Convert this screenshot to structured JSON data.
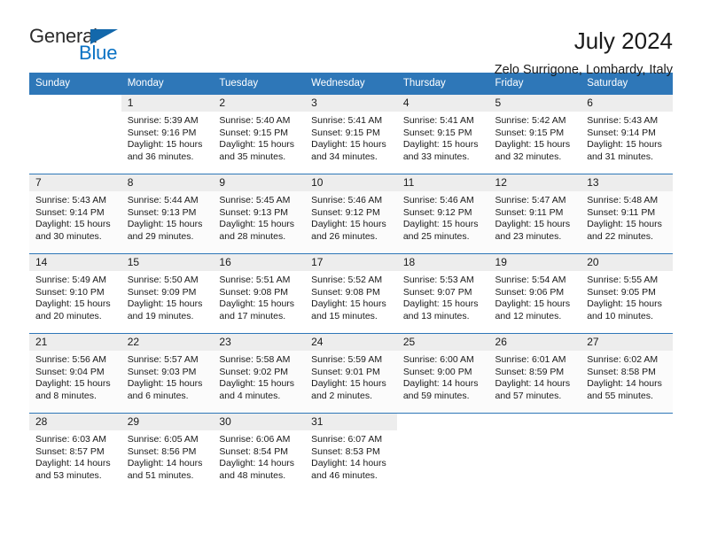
{
  "brand": {
    "name_top": "General",
    "name_bottom": "Blue",
    "accent_color": "#1368ab"
  },
  "header": {
    "title": "July 2024",
    "subtitle": "Zelo Surrigone, Lombardy, Italy"
  },
  "theme": {
    "header_row_bg": "#2e77b8",
    "header_row_text": "#ffffff",
    "daynum_band_bg": "#ededed",
    "row_divider": "#2e77b8"
  },
  "weekday_headers": [
    "Sunday",
    "Monday",
    "Tuesday",
    "Wednesday",
    "Thursday",
    "Friday",
    "Saturday"
  ],
  "labels": {
    "sunrise_prefix": "Sunrise:",
    "sunset_prefix": "Sunset:",
    "daylight_prefix": "Daylight:"
  },
  "weeks": [
    [
      {
        "day": "",
        "line1": "",
        "line2": "",
        "line3": "",
        "line4": ""
      },
      {
        "day": "1",
        "line1": "Sunrise: 5:39 AM",
        "line2": "Sunset: 9:16 PM",
        "line3": "Daylight: 15 hours",
        "line4": "and 36 minutes."
      },
      {
        "day": "2",
        "line1": "Sunrise: 5:40 AM",
        "line2": "Sunset: 9:15 PM",
        "line3": "Daylight: 15 hours",
        "line4": "and 35 minutes."
      },
      {
        "day": "3",
        "line1": "Sunrise: 5:41 AM",
        "line2": "Sunset: 9:15 PM",
        "line3": "Daylight: 15 hours",
        "line4": "and 34 minutes."
      },
      {
        "day": "4",
        "line1": "Sunrise: 5:41 AM",
        "line2": "Sunset: 9:15 PM",
        "line3": "Daylight: 15 hours",
        "line4": "and 33 minutes."
      },
      {
        "day": "5",
        "line1": "Sunrise: 5:42 AM",
        "line2": "Sunset: 9:15 PM",
        "line3": "Daylight: 15 hours",
        "line4": "and 32 minutes."
      },
      {
        "day": "6",
        "line1": "Sunrise: 5:43 AM",
        "line2": "Sunset: 9:14 PM",
        "line3": "Daylight: 15 hours",
        "line4": "and 31 minutes."
      }
    ],
    [
      {
        "day": "7",
        "line1": "Sunrise: 5:43 AM",
        "line2": "Sunset: 9:14 PM",
        "line3": "Daylight: 15 hours",
        "line4": "and 30 minutes."
      },
      {
        "day": "8",
        "line1": "Sunrise: 5:44 AM",
        "line2": "Sunset: 9:13 PM",
        "line3": "Daylight: 15 hours",
        "line4": "and 29 minutes."
      },
      {
        "day": "9",
        "line1": "Sunrise: 5:45 AM",
        "line2": "Sunset: 9:13 PM",
        "line3": "Daylight: 15 hours",
        "line4": "and 28 minutes."
      },
      {
        "day": "10",
        "line1": "Sunrise: 5:46 AM",
        "line2": "Sunset: 9:12 PM",
        "line3": "Daylight: 15 hours",
        "line4": "and 26 minutes."
      },
      {
        "day": "11",
        "line1": "Sunrise: 5:46 AM",
        "line2": "Sunset: 9:12 PM",
        "line3": "Daylight: 15 hours",
        "line4": "and 25 minutes."
      },
      {
        "day": "12",
        "line1": "Sunrise: 5:47 AM",
        "line2": "Sunset: 9:11 PM",
        "line3": "Daylight: 15 hours",
        "line4": "and 23 minutes."
      },
      {
        "day": "13",
        "line1": "Sunrise: 5:48 AM",
        "line2": "Sunset: 9:11 PM",
        "line3": "Daylight: 15 hours",
        "line4": "and 22 minutes."
      }
    ],
    [
      {
        "day": "14",
        "line1": "Sunrise: 5:49 AM",
        "line2": "Sunset: 9:10 PM",
        "line3": "Daylight: 15 hours",
        "line4": "and 20 minutes."
      },
      {
        "day": "15",
        "line1": "Sunrise: 5:50 AM",
        "line2": "Sunset: 9:09 PM",
        "line3": "Daylight: 15 hours",
        "line4": "and 19 minutes."
      },
      {
        "day": "16",
        "line1": "Sunrise: 5:51 AM",
        "line2": "Sunset: 9:08 PM",
        "line3": "Daylight: 15 hours",
        "line4": "and 17 minutes."
      },
      {
        "day": "17",
        "line1": "Sunrise: 5:52 AM",
        "line2": "Sunset: 9:08 PM",
        "line3": "Daylight: 15 hours",
        "line4": "and 15 minutes."
      },
      {
        "day": "18",
        "line1": "Sunrise: 5:53 AM",
        "line2": "Sunset: 9:07 PM",
        "line3": "Daylight: 15 hours",
        "line4": "and 13 minutes."
      },
      {
        "day": "19",
        "line1": "Sunrise: 5:54 AM",
        "line2": "Sunset: 9:06 PM",
        "line3": "Daylight: 15 hours",
        "line4": "and 12 minutes."
      },
      {
        "day": "20",
        "line1": "Sunrise: 5:55 AM",
        "line2": "Sunset: 9:05 PM",
        "line3": "Daylight: 15 hours",
        "line4": "and 10 minutes."
      }
    ],
    [
      {
        "day": "21",
        "line1": "Sunrise: 5:56 AM",
        "line2": "Sunset: 9:04 PM",
        "line3": "Daylight: 15 hours",
        "line4": "and 8 minutes."
      },
      {
        "day": "22",
        "line1": "Sunrise: 5:57 AM",
        "line2": "Sunset: 9:03 PM",
        "line3": "Daylight: 15 hours",
        "line4": "and 6 minutes."
      },
      {
        "day": "23",
        "line1": "Sunrise: 5:58 AM",
        "line2": "Sunset: 9:02 PM",
        "line3": "Daylight: 15 hours",
        "line4": "and 4 minutes."
      },
      {
        "day": "24",
        "line1": "Sunrise: 5:59 AM",
        "line2": "Sunset: 9:01 PM",
        "line3": "Daylight: 15 hours",
        "line4": "and 2 minutes."
      },
      {
        "day": "25",
        "line1": "Sunrise: 6:00 AM",
        "line2": "Sunset: 9:00 PM",
        "line3": "Daylight: 14 hours",
        "line4": "and 59 minutes."
      },
      {
        "day": "26",
        "line1": "Sunrise: 6:01 AM",
        "line2": "Sunset: 8:59 PM",
        "line3": "Daylight: 14 hours",
        "line4": "and 57 minutes."
      },
      {
        "day": "27",
        "line1": "Sunrise: 6:02 AM",
        "line2": "Sunset: 8:58 PM",
        "line3": "Daylight: 14 hours",
        "line4": "and 55 minutes."
      }
    ],
    [
      {
        "day": "28",
        "line1": "Sunrise: 6:03 AM",
        "line2": "Sunset: 8:57 PM",
        "line3": "Daylight: 14 hours",
        "line4": "and 53 minutes."
      },
      {
        "day": "29",
        "line1": "Sunrise: 6:05 AM",
        "line2": "Sunset: 8:56 PM",
        "line3": "Daylight: 14 hours",
        "line4": "and 51 minutes."
      },
      {
        "day": "30",
        "line1": "Sunrise: 6:06 AM",
        "line2": "Sunset: 8:54 PM",
        "line3": "Daylight: 14 hours",
        "line4": "and 48 minutes."
      },
      {
        "day": "31",
        "line1": "Sunrise: 6:07 AM",
        "line2": "Sunset: 8:53 PM",
        "line3": "Daylight: 14 hours",
        "line4": "and 46 minutes."
      },
      {
        "day": "",
        "line1": "",
        "line2": "",
        "line3": "",
        "line4": ""
      },
      {
        "day": "",
        "line1": "",
        "line2": "",
        "line3": "",
        "line4": ""
      },
      {
        "day": "",
        "line1": "",
        "line2": "",
        "line3": "",
        "line4": ""
      }
    ]
  ]
}
